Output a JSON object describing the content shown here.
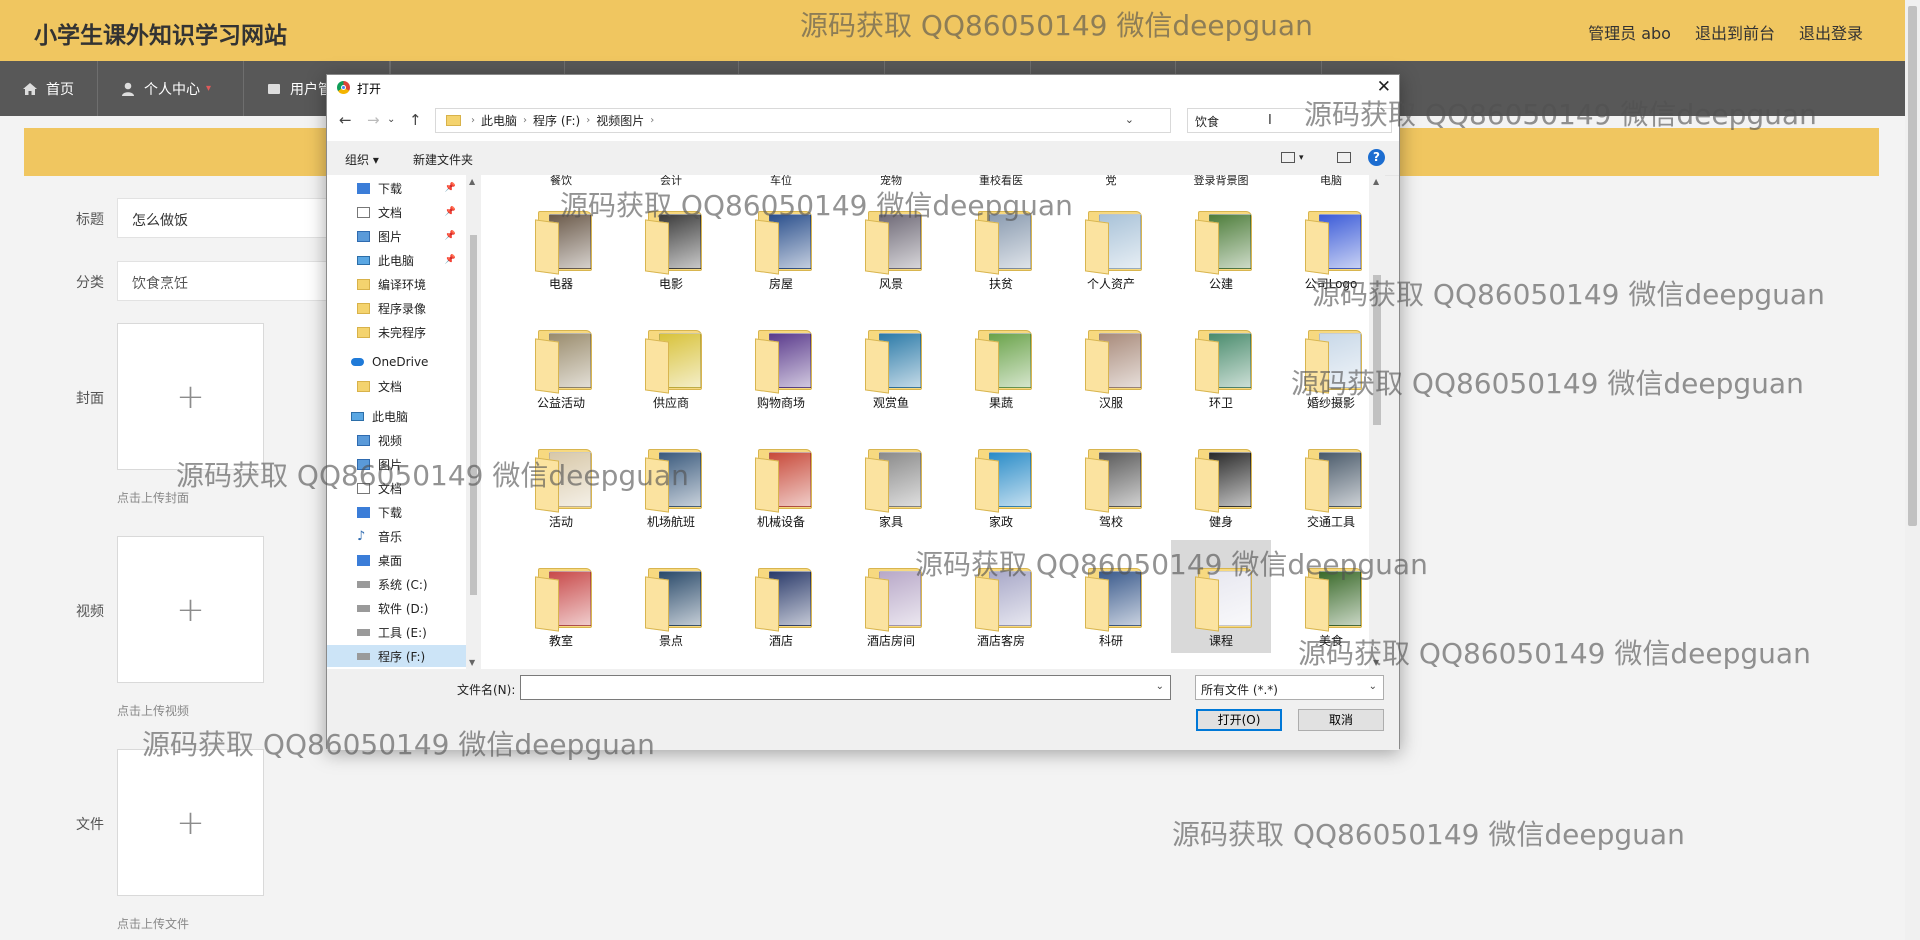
{
  "site": {
    "title": "小学生课外知识学习网站",
    "header_links": [
      "管理员 abo",
      "退出到前台",
      "退出登录"
    ]
  },
  "nav": {
    "items": [
      {
        "label": "首页",
        "icon": "home-icon"
      },
      {
        "label": "个人中心",
        "icon": "user-icon",
        "has_dropdown": true
      },
      {
        "label": "用户管",
        "icon": "users-icon"
      }
    ]
  },
  "form": {
    "title_label": "标题",
    "title_value": "怎么做饭",
    "category_label": "分类",
    "category_value": "饮食烹饪",
    "cover_label": "封面",
    "cover_hint": "点击上传封面",
    "video_label": "视频",
    "video_hint": "点击上传视频",
    "file_label": "文件",
    "file_hint": "点击上传文件",
    "upload_symbol": "+"
  },
  "dialog": {
    "title": "打开",
    "close": "✕",
    "breadcrumbs": [
      "此电脑",
      "程序 (F:)",
      "视频图片"
    ],
    "search_value": "饮食",
    "toolbar": {
      "organize": "组织 ▾",
      "new_folder": "新建文件夹",
      "help": "?"
    },
    "tree": [
      {
        "label": "下载",
        "icon": "download-icon",
        "pinned": true
      },
      {
        "label": "文档",
        "icon": "document-icon",
        "pinned": true
      },
      {
        "label": "图片",
        "icon": "pictures-icon",
        "pinned": true
      },
      {
        "label": "此电脑",
        "icon": "computer-icon",
        "pinned": true
      },
      {
        "label": "编译环境",
        "icon": "folder-icon"
      },
      {
        "label": "程序录像",
        "icon": "folder-icon"
      },
      {
        "label": "未完程序",
        "icon": "folder-icon"
      },
      {
        "label": "OneDrive",
        "icon": "cloud-icon"
      },
      {
        "label": "文档",
        "icon": "folder-icon"
      },
      {
        "label": "此电脑",
        "icon": "computer-icon"
      },
      {
        "label": "视频",
        "icon": "video-icon"
      },
      {
        "label": "图片",
        "icon": "pictures-icon"
      },
      {
        "label": "文档",
        "icon": "document-icon"
      },
      {
        "label": "下载",
        "icon": "download-icon"
      },
      {
        "label": "音乐",
        "icon": "music-icon"
      },
      {
        "label": "桌面",
        "icon": "desktop-icon"
      },
      {
        "label": "系统 (C:)",
        "icon": "drive-icon"
      },
      {
        "label": "软件 (D:)",
        "icon": "drive-icon"
      },
      {
        "label": "工具 (E:)",
        "icon": "drive-icon"
      },
      {
        "label": "程序 (F:)",
        "icon": "drive-icon",
        "selected": true
      }
    ],
    "top_cut_labels": [
      "餐饮",
      "会计",
      "车位",
      "宠物",
      "重校看医",
      "党",
      "登录背景图",
      "电脑"
    ],
    "folders": [
      {
        "label": "电器",
        "color": "#6b5a4a"
      },
      {
        "label": "电影",
        "color": "#3b3b3b"
      },
      {
        "label": "房屋",
        "color": "#2a4f8c"
      },
      {
        "label": "风景",
        "color": "#6f6a77"
      },
      {
        "label": "扶贫",
        "color": "#8a9bb0"
      },
      {
        "label": "个人资产",
        "color": "#a8c2d8"
      },
      {
        "label": "公建",
        "color": "#4d7d3a"
      },
      {
        "label": "公司Logo",
        "color": "#3b5bd8"
      },
      {
        "label": "公益活动",
        "color": "#9a8c6d"
      },
      {
        "label": "供应商",
        "color": "#d8c23a"
      },
      {
        "label": "购物商场",
        "color": "#5a3a8c"
      },
      {
        "label": "观赏鱼",
        "color": "#2b7aa8"
      },
      {
        "label": "果蔬",
        "color": "#6aa34a"
      },
      {
        "label": "汉服",
        "color": "#a88a7a"
      },
      {
        "label": "环卫",
        "color": "#4a8c6d"
      },
      {
        "label": "婚纱摄影",
        "color": "#c8d8e8"
      },
      {
        "label": "活动",
        "color": "#d8c8a8"
      },
      {
        "label": "机场航班",
        "color": "#3a5a7d"
      },
      {
        "label": "机械设备",
        "color": "#c84a3a"
      },
      {
        "label": "家具",
        "color": "#8a8a8a"
      },
      {
        "label": "家政",
        "color": "#2a8cc8"
      },
      {
        "label": "驾校",
        "color": "#5a5a5a"
      },
      {
        "label": "健身",
        "color": "#2a2a2a"
      },
      {
        "label": "交通工具",
        "color": "#4a5a6a"
      },
      {
        "label": "教室",
        "color": "#c84a4a"
      },
      {
        "label": "景点",
        "color": "#2a4a6a"
      },
      {
        "label": "酒店",
        "color": "#2a3a6a"
      },
      {
        "label": "酒店房间",
        "color": "#b8a8c8"
      },
      {
        "label": "酒店客房",
        "color": "#a8a8c8"
      },
      {
        "label": "科研",
        "color": "#3a5a8c"
      },
      {
        "label": "课程",
        "color": "#e8e8f0",
        "selected": true
      },
      {
        "label": "美食",
        "color": "#3a6a2a"
      }
    ],
    "filename_label": "文件名(N):",
    "filename_value": "",
    "filetype_value": "所有文件 (*.*)",
    "open_button": "打开(O)",
    "cancel_button": "取消"
  },
  "watermark_text": "源码获取 QQ86050149 微信deepguan"
}
